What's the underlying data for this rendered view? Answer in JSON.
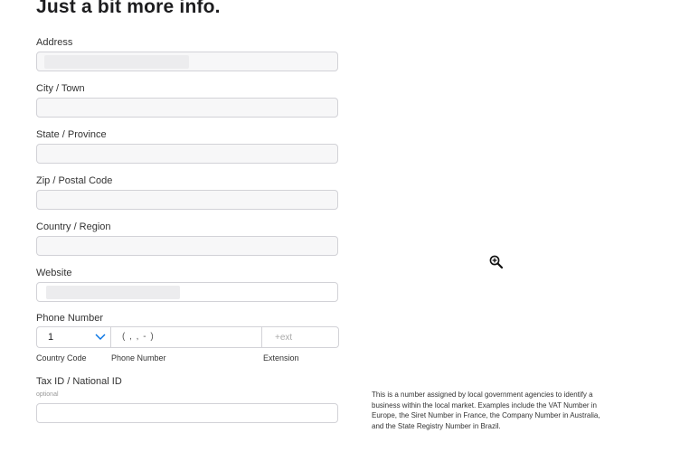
{
  "form": {
    "title": "Just a bit more info.",
    "fields": {
      "address": "Address",
      "city": "City / Town",
      "state": "State / Province",
      "zip": "Zip / Postal Code",
      "country": "Country / Region",
      "website": "Website"
    },
    "phone": {
      "label": "Phone Number",
      "country_code_value": "1",
      "phone_value": "( , ,  -  )",
      "extension_placeholder": "+ext",
      "country_code_caption": "Country Code",
      "phone_caption": "Phone Number",
      "extension_caption": "Extension"
    },
    "tax": {
      "label": "Tax ID / National ID",
      "optional": "optional",
      "help": "This is a number assigned by local government agencies to identify a business within the local market. Examples include the VAT Number in Europe, the Siret Number in France, the Company Number in Australia, and the State Registry Number in Brazil."
    }
  },
  "colors": {
    "field_border": "#d2d2d7",
    "field_bg": "#f7f7f8",
    "chevron": "#0071e3"
  },
  "icons": {
    "cursor": "zoom-in-cursor-icon",
    "dropdown": "chevron-down-icon"
  }
}
